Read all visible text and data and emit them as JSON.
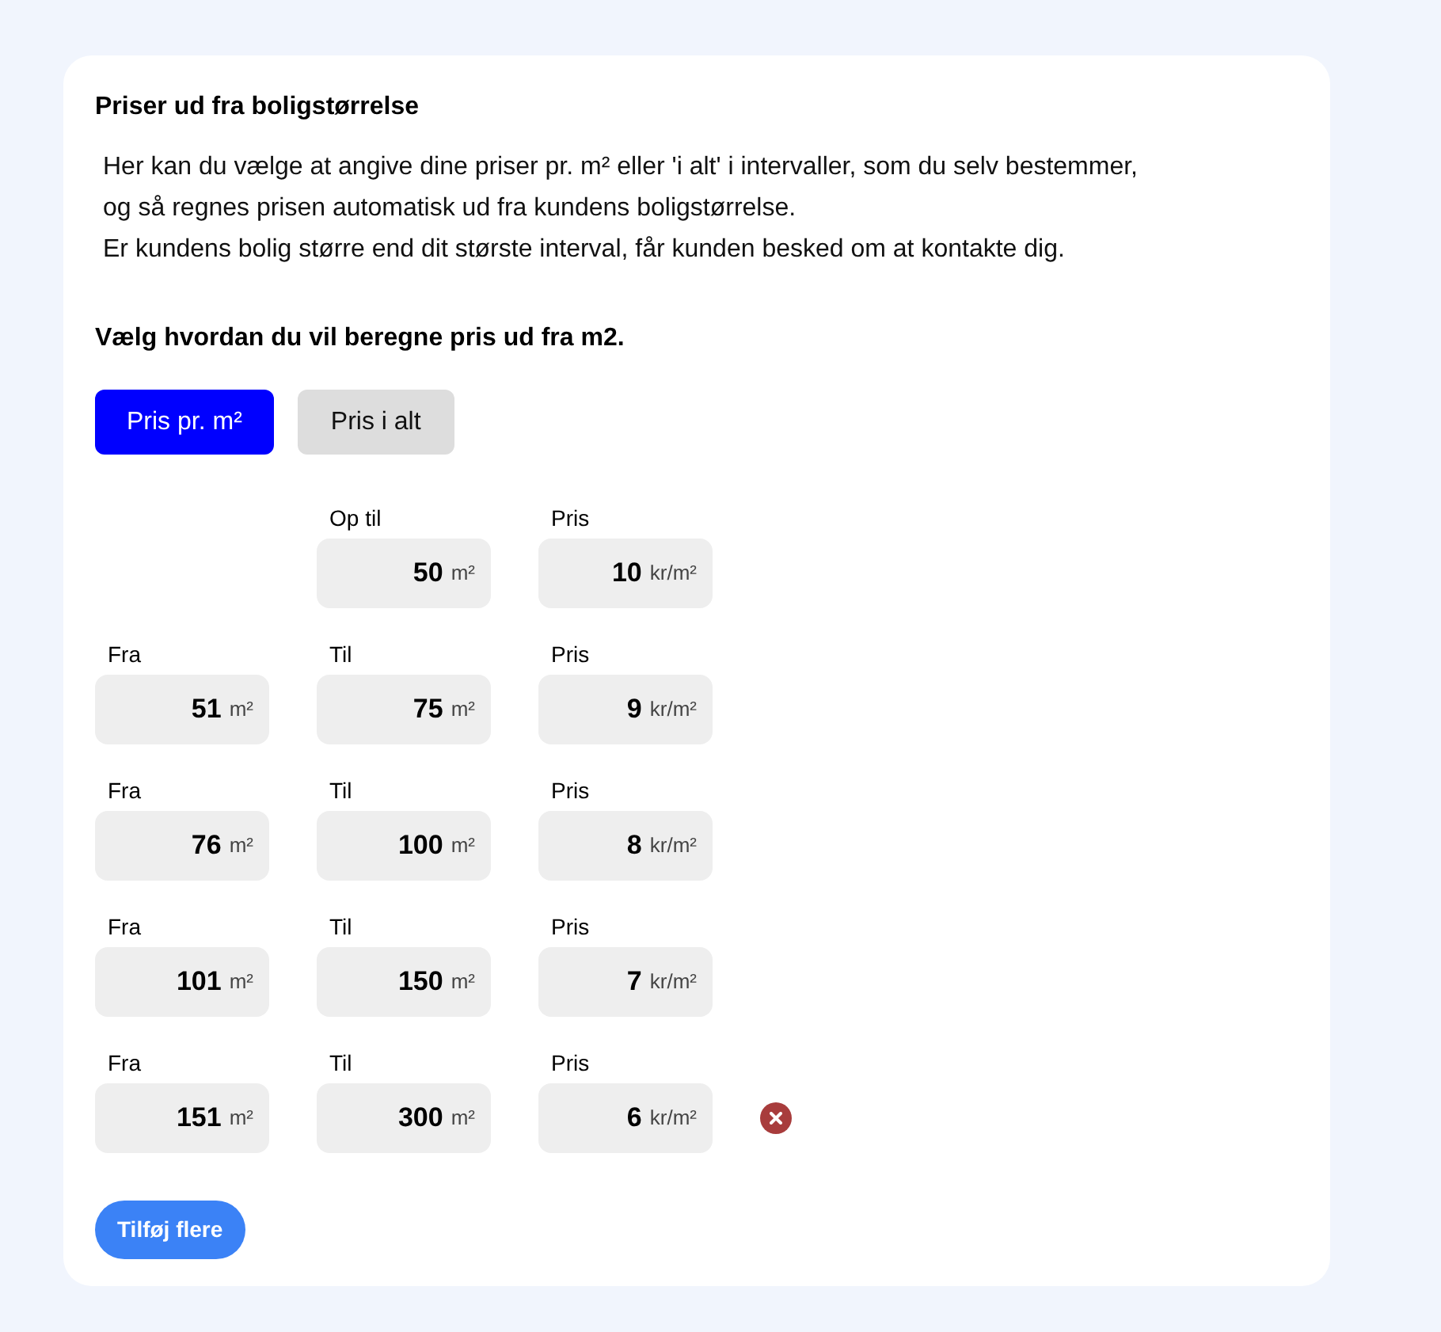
{
  "card": {
    "title": "Priser ud fra boligstørrelse",
    "description": [
      "Her kan du vælge at angive dine priser pr. m² eller 'i alt' i intervaller, som du selv bestemmer,",
      "og så regnes prisen automatisk ud fra kundens boligstørrelse.",
      "Er kundens bolig større end dit største interval, får kunden besked om at kontakte dig."
    ],
    "method_heading": "Vælg hvordan du vil beregne pris ud fra m2.",
    "method_tabs": [
      {
        "label": "Pris pr. m²",
        "selected": true
      },
      {
        "label": "Pris i alt",
        "selected": false
      }
    ],
    "intervals": [
      {
        "to": {
          "label": "Op til",
          "value": "50",
          "unit": "m²"
        },
        "price": {
          "label": "Pris",
          "value": "10",
          "unit": "kr/m²"
        },
        "removable": false
      },
      {
        "from": {
          "label": "Fra",
          "value": "51",
          "unit": "m²"
        },
        "to": {
          "label": "Til",
          "value": "75",
          "unit": "m²"
        },
        "price": {
          "label": "Pris",
          "value": "9",
          "unit": "kr/m²"
        },
        "removable": false
      },
      {
        "from": {
          "label": "Fra",
          "value": "76",
          "unit": "m²"
        },
        "to": {
          "label": "Til",
          "value": "100",
          "unit": "m²"
        },
        "price": {
          "label": "Pris",
          "value": "8",
          "unit": "kr/m²"
        },
        "removable": false
      },
      {
        "from": {
          "label": "Fra",
          "value": "101",
          "unit": "m²"
        },
        "to": {
          "label": "Til",
          "value": "150",
          "unit": "m²"
        },
        "price": {
          "label": "Pris",
          "value": "7",
          "unit": "kr/m²"
        },
        "removable": false
      },
      {
        "from": {
          "label": "Fra",
          "value": "151",
          "unit": "m²"
        },
        "to": {
          "label": "Til",
          "value": "300",
          "unit": "m²"
        },
        "price": {
          "label": "Pris",
          "value": "6",
          "unit": "kr/m²"
        },
        "removable": true
      }
    ],
    "add_button": "Tilføj flere"
  }
}
